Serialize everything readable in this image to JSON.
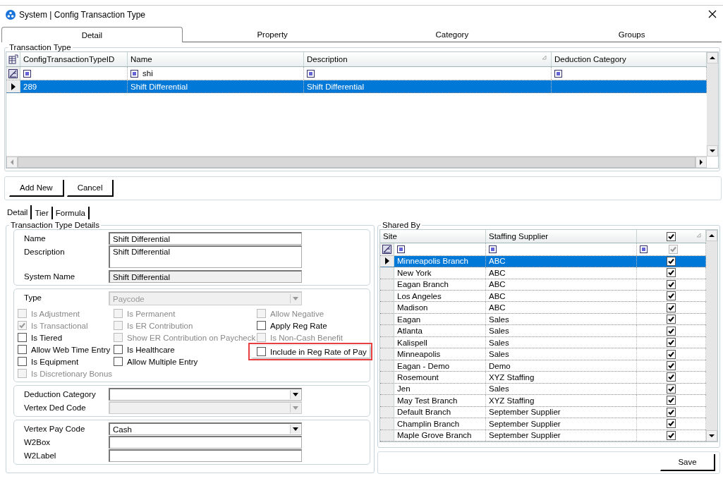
{
  "window": {
    "title": "System | Config Transaction Type"
  },
  "tabs": [
    {
      "label": "Detail",
      "selected": true
    },
    {
      "label": "Property",
      "selected": false
    },
    {
      "label": "Category",
      "selected": false
    },
    {
      "label": "Groups",
      "selected": false
    }
  ],
  "transaction_type": {
    "title": "Transaction Type",
    "columns": [
      "ConfigTransactionTypeID",
      "Name",
      "Description",
      "Deduction Category"
    ],
    "filter_name": "shi",
    "rows": [
      {
        "id": "289",
        "name": "Shift Differential",
        "description": "Shift Differential",
        "selected": true
      }
    ]
  },
  "buttons": [
    "Add New",
    "Cancel"
  ],
  "subtabs": [
    {
      "label": "Detail",
      "selected": true
    },
    {
      "label": "Tier",
      "selected": false
    },
    {
      "label": "Formula",
      "selected": false
    }
  ],
  "details": {
    "title": "Transaction Type Details",
    "name": {
      "label": "Name",
      "value": "Shift Differential"
    },
    "description": {
      "label": "Description",
      "value": "Shift Differential"
    },
    "system_name": {
      "label": "System Name",
      "value": "Shift Differential",
      "disabled": true
    },
    "type": {
      "label": "Type",
      "value": "Paycode",
      "disabled": true
    },
    "checkbox_columns": [
      [
        {
          "label": "Is Adjustment",
          "checked": false,
          "disabled": true,
          "highlighted": false
        },
        {
          "label": "Is Transactional",
          "checked": true,
          "disabled": true,
          "highlighted": false
        },
        {
          "label": "Is Tiered",
          "checked": false,
          "disabled": false,
          "highlighted": false
        },
        {
          "label": "Allow Web Time Entry",
          "checked": false,
          "disabled": false,
          "highlighted": false
        },
        {
          "label": "Is Equipment",
          "checked": false,
          "disabled": false,
          "highlighted": false
        },
        {
          "label": "Is Discretionary Bonus",
          "checked": false,
          "disabled": true,
          "highlighted": false
        }
      ],
      [
        {
          "label": "Is Permanent",
          "checked": false,
          "disabled": true,
          "highlighted": false
        },
        {
          "label": "Is ER Contribution",
          "checked": false,
          "disabled": true,
          "highlighted": false
        },
        {
          "label": "Show ER Contribution on Paycheck",
          "checked": false,
          "disabled": true,
          "highlighted": false
        },
        {
          "label": "Is Healthcare",
          "checked": false,
          "disabled": false,
          "highlighted": false
        },
        {
          "label": "Allow Multiple Entry",
          "checked": false,
          "disabled": false,
          "highlighted": false
        }
      ],
      [
        {
          "label": "Allow Negative",
          "checked": false,
          "disabled": true,
          "highlighted": false
        },
        {
          "label": "Apply Reg Rate",
          "checked": false,
          "disabled": false,
          "highlighted": false
        },
        {
          "label": "Is Non-Cash Benefit",
          "checked": false,
          "disabled": true,
          "highlighted": false
        },
        {
          "label": "Include in Reg Rate of Pay",
          "checked": false,
          "disabled": false,
          "highlighted": true
        }
      ]
    ],
    "deduction_category": {
      "label": "Deduction Category",
      "disabled": false
    },
    "vertex_ded_code": {
      "label": "Vertex Ded Code",
      "disabled": true
    },
    "vertex_pay_code": {
      "label": "Vertex Pay Code",
      "value": "Cash",
      "disabled": false
    },
    "w2box": {
      "label": "W2Box"
    },
    "w2label": {
      "label": "W2Label"
    }
  },
  "shared_by": {
    "title": "Shared By",
    "columns": [
      "Site",
      "Staffing Supplier"
    ],
    "header_checked": true,
    "filter_checked": true,
    "rows": [
      {
        "site": "Minneapolis Branch",
        "supplier": "ABC",
        "checked": true,
        "selected": true
      },
      {
        "site": "New York",
        "supplier": "ABC",
        "checked": true,
        "selected": false
      },
      {
        "site": "Eagan Branch",
        "supplier": "ABC",
        "checked": true,
        "selected": false
      },
      {
        "site": "Los Angeles",
        "supplier": "ABC",
        "checked": true,
        "selected": false
      },
      {
        "site": "Madison",
        "supplier": "ABC",
        "checked": true,
        "selected": false
      },
      {
        "site": "Eagan",
        "supplier": "Sales",
        "checked": true,
        "selected": false
      },
      {
        "site": "Atlanta",
        "supplier": "Sales",
        "checked": true,
        "selected": false
      },
      {
        "site": "Kalispell",
        "supplier": "Sales",
        "checked": true,
        "selected": false
      },
      {
        "site": "Minneapolis",
        "supplier": "Sales",
        "checked": true,
        "selected": false
      },
      {
        "site": "Eagan - Demo",
        "supplier": "Demo",
        "checked": true,
        "selected": false
      },
      {
        "site": "Rosemount",
        "supplier": "XYZ Staffing",
        "checked": true,
        "selected": false
      },
      {
        "site": "Jen",
        "supplier": "Sales",
        "checked": true,
        "selected": false
      },
      {
        "site": "May Test Branch",
        "supplier": "XYZ Staffing",
        "checked": true,
        "selected": false
      },
      {
        "site": "Default Branch",
        "supplier": "September Supplier",
        "checked": true,
        "selected": false
      },
      {
        "site": "Champlin Branch",
        "supplier": "September Supplier",
        "checked": true,
        "selected": false
      },
      {
        "site": "Maple Grove Branch",
        "supplier": "September Supplier",
        "checked": true,
        "selected": false
      }
    ]
  },
  "save_button": "Save"
}
